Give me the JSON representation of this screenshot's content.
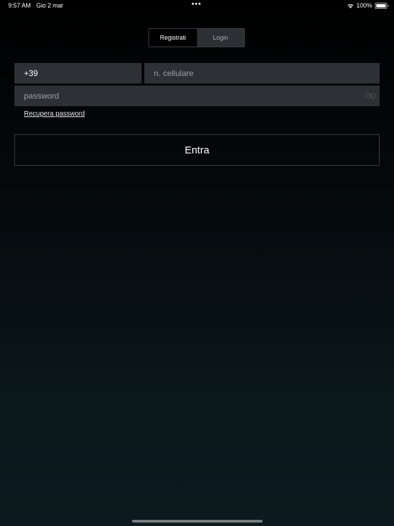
{
  "status_bar": {
    "time": "9:57 AM",
    "date": "Gio 2 mar",
    "center_dots": "•••",
    "battery_percent": "100%",
    "wifi_icon": "wifi-icon",
    "battery_icon": "battery-icon",
    "battery_level": 1.0
  },
  "segmented": {
    "registrati_label": "Registrati",
    "login_label": "Login",
    "selected": "Registrati"
  },
  "form": {
    "prefix_value": "+39",
    "phone_placeholder": "n. cellulare",
    "phone_value": "",
    "password_placeholder": "password",
    "password_value": "",
    "password_visibility_icon": "eye-off-icon",
    "recover_label": "Recupera password",
    "submit_label": "Entra"
  },
  "colors": {
    "field_background": "#2d3136",
    "segment_inactive": "#2c3035",
    "border": "#3a3d41",
    "text": "#ffffff",
    "placeholder": "#9aa0a6"
  }
}
